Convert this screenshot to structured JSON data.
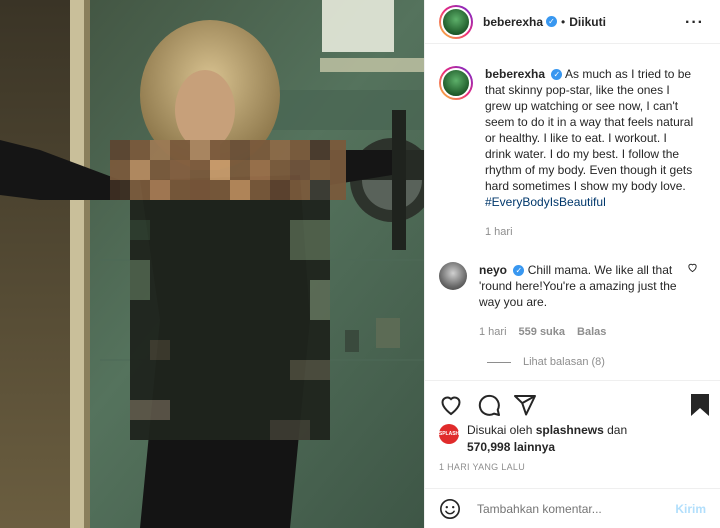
{
  "post": {
    "username": "beberexha",
    "follow_state": "Diikuti",
    "caption": "As much as I tried to be that skinny pop-star, like the ones I grew up watching or see now, I can't seem to do it in a way that feels natural or healthy. I like to eat. I workout. I drink water. I do my best. I follow the rhythm of my body. Even though it gets hard sometimes I show my body love.",
    "hashtag": "#EveryBodyIsBeautiful",
    "caption_time": "1 hari"
  },
  "comment": {
    "username": "neyo",
    "text": "Chill mama. We like all that 'round here!You're a amazing just the way you are.",
    "time": "1 hari",
    "likes": "559 suka",
    "reply_label": "Balas",
    "view_replies": "Lihat balasan (8)"
  },
  "likes": {
    "prefix": "Disukai oleh",
    "first_user": "splashnews",
    "connector": "dan",
    "count": "570,998",
    "suffix": "lainnya",
    "avatar_text": "SPLASH"
  },
  "timestamp": "1 HARI YANG LALU",
  "add_comment": {
    "placeholder": "Tambahkan komentar...",
    "send_label": "Kirim"
  },
  "icons": {
    "like": "heart-icon",
    "comment": "comment-icon",
    "share": "share-icon",
    "save": "bookmark-icon",
    "emoji": "emoji-icon",
    "more": "more-icon",
    "verified": "verified-badge-icon"
  },
  "colors": {
    "verified": "#3897f0",
    "hashtag": "#00376b",
    "secondary_text": "#8e8e8e",
    "send_disabled": "#b2dffc"
  }
}
